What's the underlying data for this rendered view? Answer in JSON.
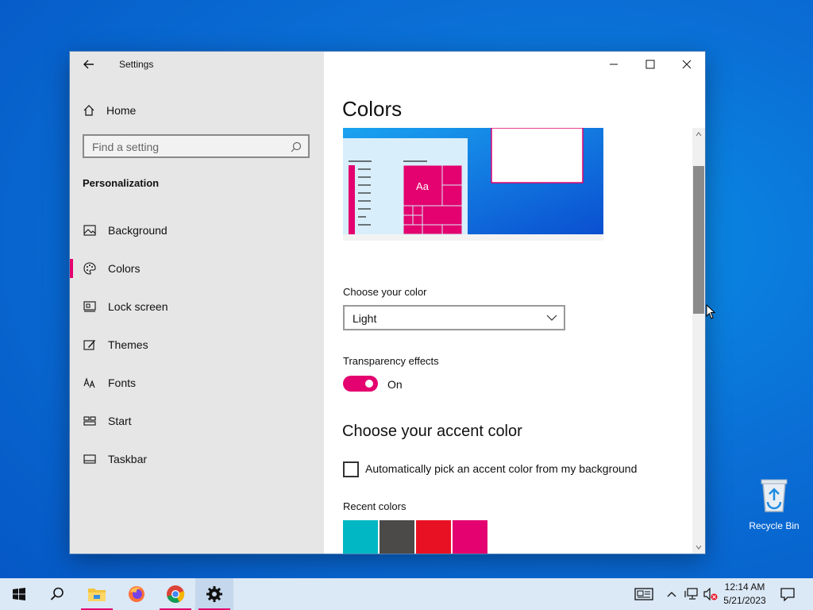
{
  "window": {
    "title": "Settings",
    "home_label": "Home",
    "search_placeholder": "Find a setting",
    "section_title": "Personalization",
    "nav": [
      {
        "label": "Background",
        "icon": "picture-icon",
        "active": false
      },
      {
        "label": "Colors",
        "icon": "palette-icon",
        "active": true
      },
      {
        "label": "Lock screen",
        "icon": "lock-screen-icon",
        "active": false
      },
      {
        "label": "Themes",
        "icon": "themes-icon",
        "active": false
      },
      {
        "label": "Fonts",
        "icon": "fonts-icon",
        "active": false
      },
      {
        "label": "Start",
        "icon": "start-icon",
        "active": false
      },
      {
        "label": "Taskbar",
        "icon": "taskbar-icon",
        "active": false
      }
    ]
  },
  "content": {
    "title": "Colors",
    "preview_tile_text": "Aa",
    "choose_color_label": "Choose your color",
    "choose_color_value": "Light",
    "transparency_label": "Transparency effects",
    "transparency_state": "On",
    "accent_heading": "Choose your accent color",
    "auto_accent_label": "Automatically pick an accent color from my background",
    "auto_accent_checked": false,
    "recent_colors_label": "Recent colors",
    "recent_colors": [
      "#00b7c3",
      "#4c4a48",
      "#e81123",
      "#e3026f"
    ]
  },
  "desktop": {
    "recycle_bin_label": "Recycle Bin"
  },
  "taskbar": {
    "time": "12:14 AM",
    "date": "5/21/2023",
    "apps": [
      "file-explorer-icon",
      "firefox-icon",
      "chrome-icon",
      "settings-icon"
    ]
  },
  "colors": {
    "accent": "#e3026f",
    "sidebar_bg": "#e6e6e6",
    "taskbar_bg": "#dbe8f5"
  }
}
